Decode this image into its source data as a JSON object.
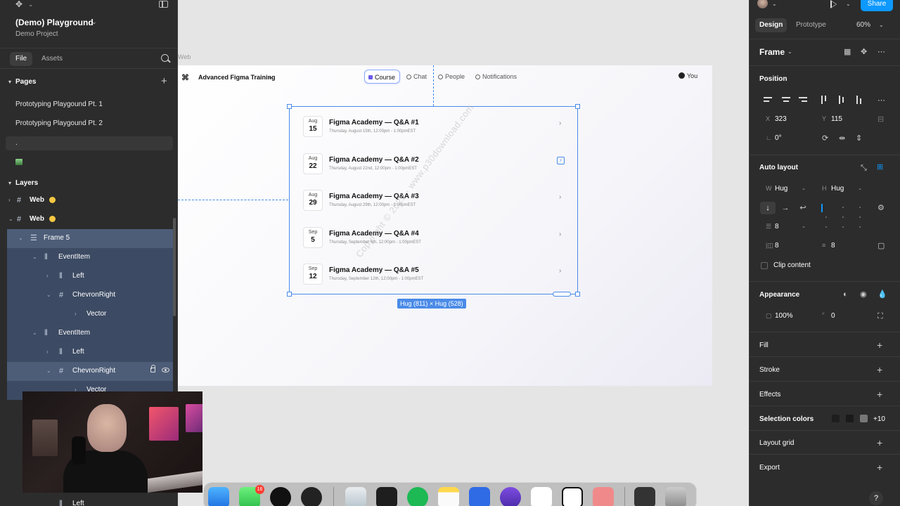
{
  "left_panel": {
    "project_title": "(Demo) Playground",
    "project_subtitle": "Demo Project",
    "tabs": {
      "file": "File",
      "assets": "Assets"
    },
    "pages_header": "Pages",
    "pages": [
      {
        "label": "Prototyping Playgound Pt. 1"
      },
      {
        "label": "Prototyping Playgound Pt. 2"
      },
      {
        "label": "."
      }
    ],
    "layers_header": "Layers",
    "layers": [
      {
        "label": "Web",
        "icon": "frame-icon"
      },
      {
        "label": "Web",
        "icon": "frame-icon"
      },
      {
        "label": "Frame 5",
        "icon": "vertical-stack-icon"
      },
      {
        "label": "EventItem",
        "icon": "horizontal-stack-icon"
      },
      {
        "label": "Left",
        "icon": "horizontal-stack-icon"
      },
      {
        "label": "ChevronRight",
        "icon": "frame-icon"
      },
      {
        "label": "Vector",
        "icon": "vector-icon"
      },
      {
        "label": "EventItem",
        "icon": "horizontal-stack-icon"
      },
      {
        "label": "Left",
        "icon": "horizontal-stack-icon"
      },
      {
        "label": "ChevronRight",
        "icon": "frame-icon"
      },
      {
        "label": "Vector",
        "icon": "vector-icon"
      },
      {
        "label": "Left",
        "icon": "horizontal-stack-icon"
      }
    ]
  },
  "canvas": {
    "frame_label": "Web",
    "nav": {
      "title": "Advanced Figma Training",
      "tabs": [
        "Course",
        "Chat",
        "People",
        "Notifications"
      ],
      "user": "You"
    },
    "events": [
      {
        "month": "Aug",
        "day": "15",
        "title": "Figma Academy — Q&A #1",
        "subtitle": "Thursday, August 15th, 12:00pm - 1:00pmEST"
      },
      {
        "month": "Aug",
        "day": "22",
        "title": "Figma Academy — Q&A #2",
        "subtitle": "Thursday, August 22nd, 12:00pm - 1:00pmEST"
      },
      {
        "month": "Aug",
        "day": "29",
        "title": "Figma Academy — Q&A #3",
        "subtitle": "Thursday, August 29th, 12:00pm - 1:00pmEST"
      },
      {
        "month": "Sep",
        "day": "5",
        "title": "Figma Academy — Q&A #4",
        "subtitle": "Thursday, September 5th, 12:00pm - 1:00pmEST"
      },
      {
        "month": "Sep",
        "day": "12",
        "title": "Figma Academy — Q&A #5",
        "subtitle": "Thursday, September 12th, 12:00pm - 1:00pmEST"
      }
    ],
    "size_badge": "Hug (811) × Hug (528)",
    "watermark": "Copyright © 2025 - www.p30download.com",
    "dock": {
      "messages_badge": "16"
    }
  },
  "right_panel": {
    "share": "Share",
    "tabs": {
      "design": "Design",
      "prototype": "Prototype"
    },
    "zoom": "60%",
    "frame_type": "Frame",
    "position": {
      "title": "Position",
      "x_label": "X",
      "x": "323",
      "y_label": "Y",
      "y": "115",
      "rotation": "0°"
    },
    "auto_layout": {
      "title": "Auto layout",
      "w_label": "W",
      "width": "Hug",
      "h_label": "H",
      "height": "Hug",
      "gap": "8",
      "padding_h": "8",
      "padding_v": "8",
      "clip_content": "Clip content"
    },
    "appearance": {
      "title": "Appearance",
      "opacity": "100%",
      "radius": "0"
    },
    "sections": {
      "fill": "Fill",
      "stroke": "Stroke",
      "effects": "Effects",
      "selection_colors": "Selection colors",
      "selection_colors_more": "+10",
      "layout_grid": "Layout grid",
      "export": "Export"
    },
    "help": "?"
  },
  "colors": {
    "panel_bg": "#2c2c2c",
    "selection_blue": "#4a8be8",
    "share_blue": "#0d99ff",
    "layer_selection": "#3c4a63"
  }
}
